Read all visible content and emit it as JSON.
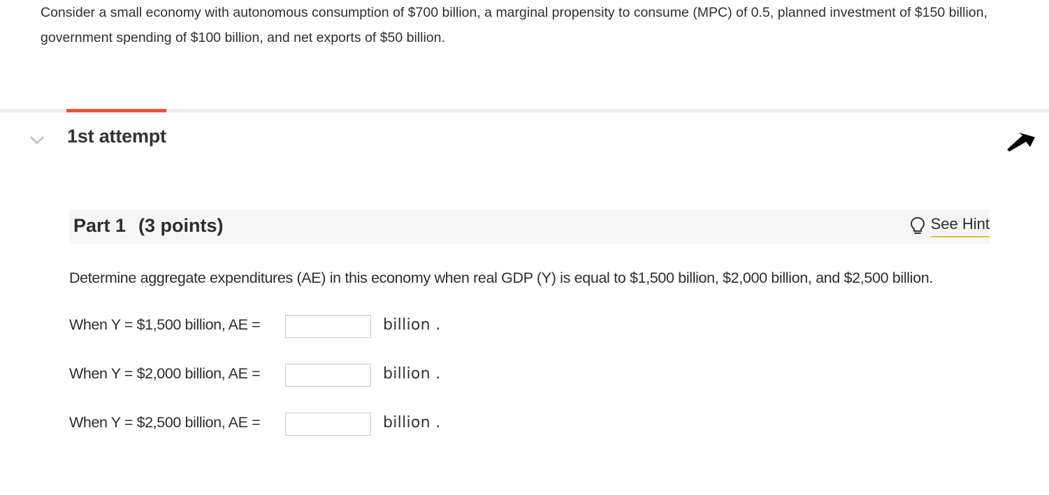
{
  "problem": {
    "intro": "Consider a small economy with autonomous consumption of $700 billion, a marginal propensity to consume (MPC) of 0.5, planned investment of $150 billion, government spending of $100 billion, and net exports of $50 billion."
  },
  "attempt": {
    "title": "1st attempt"
  },
  "part": {
    "title": "Part 1",
    "points": "(3 points)",
    "hint_label": "See Hint",
    "question": "Determine aggregate expenditures (AE) in this economy when real GDP (Y) is equal to $1,500 billion, $2,000 billion, and $2,500 billion.",
    "rows": [
      {
        "label": "When Y = $1,500 billion, AE =",
        "value": "",
        "unit": "billion",
        "period": "."
      },
      {
        "label": "When Y = $2,000 billion, AE =",
        "value": "",
        "unit": "billion",
        "period": "."
      },
      {
        "label": "When Y = $2,500 billion, AE =",
        "value": "",
        "unit": "billion",
        "period": "."
      }
    ]
  },
  "colors": {
    "accent": "#e8553b",
    "hint_underline": "#f0b43c",
    "header_bg": "#f6f6f6",
    "divider": "#ececec"
  },
  "icons": {
    "chevron": "chevron-down-icon",
    "hint": "lightbulb-icon",
    "cursor": "mouse-pointer-icon"
  }
}
